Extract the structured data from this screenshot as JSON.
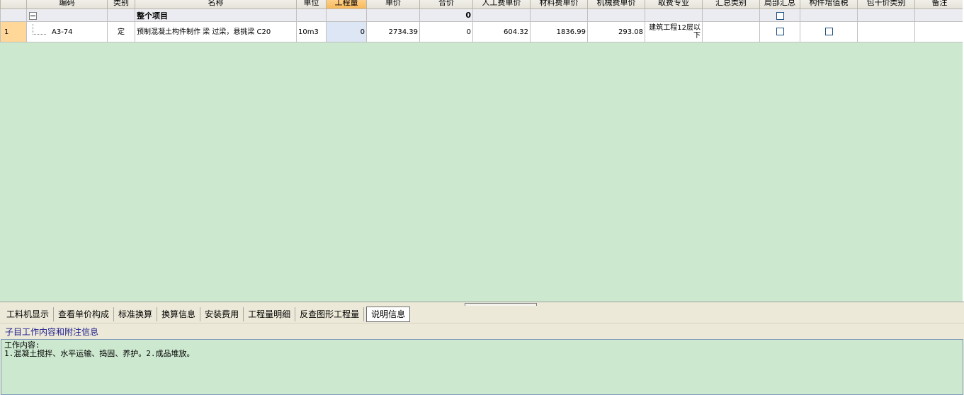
{
  "grid": {
    "columns": [
      {
        "key": "rownum",
        "label": ""
      },
      {
        "key": "code",
        "label": "编码"
      },
      {
        "key": "category",
        "label": "类别"
      },
      {
        "key": "name",
        "label": "名称"
      },
      {
        "key": "unit",
        "label": "单位"
      },
      {
        "key": "qty",
        "label": "工程量"
      },
      {
        "key": "unit_price",
        "label": "单价"
      },
      {
        "key": "total_price",
        "label": "合价"
      },
      {
        "key": "labor",
        "label": "人工费单价"
      },
      {
        "key": "material",
        "label": "材料费单价"
      },
      {
        "key": "machine",
        "label": "机械费单价"
      },
      {
        "key": "fee_specialty",
        "label": "取费专业"
      },
      {
        "key": "summary_type",
        "label": "汇总类别"
      },
      {
        "key": "local_summary",
        "label": "局部汇总"
      },
      {
        "key": "component_vat",
        "label": "构件增值税"
      },
      {
        "key": "lumpsum_type",
        "label": "包干价类别"
      },
      {
        "key": "remark",
        "label": "备注"
      }
    ],
    "group_row": {
      "name": "整个项目",
      "total_price": "0"
    },
    "rows": [
      {
        "rownum": "1",
        "code": "A3-74",
        "category": "定",
        "name": "预制混凝土构件制作 梁 过梁，悬挑梁 C20",
        "unit": "10m3",
        "qty": "0",
        "unit_price": "2734.39",
        "total_price": "0",
        "labor": "604.32",
        "material": "1836.99",
        "machine": "293.08",
        "fee_specialty": "建筑工程12层以下",
        "summary_type": "",
        "remark": ""
      }
    ]
  },
  "tabs": [
    {
      "label": "工料机显示",
      "active": false
    },
    {
      "label": "查看单价构成",
      "active": false
    },
    {
      "label": "标准换算",
      "active": false
    },
    {
      "label": "换算信息",
      "active": false
    },
    {
      "label": "安装费用",
      "active": false
    },
    {
      "label": "工程量明细",
      "active": false
    },
    {
      "label": "反查图形工程量",
      "active": false
    },
    {
      "label": "说明信息",
      "active": true
    }
  ],
  "subheader": {
    "title": "子目工作内容和附注信息"
  },
  "description": {
    "line1": "工作内容:",
    "line2": "1.混凝土搅拌、水平运输、捣固、养护。2.成品堆放。"
  }
}
